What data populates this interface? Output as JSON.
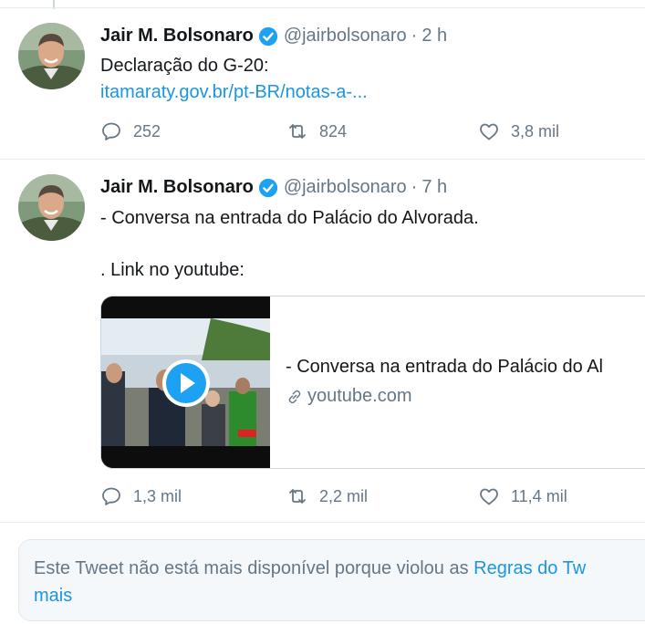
{
  "tweets": [
    {
      "author_name": "Jair M. Bolsonaro",
      "handle": "@jairbolsonaro",
      "separator": "·",
      "time": "2 h",
      "text_line1": "Declaração do G-20:",
      "link": "itamaraty.gov.br/pt-BR/notas-a-...",
      "replies": "252",
      "retweets": "824",
      "likes": "3,8 mil"
    },
    {
      "author_name": "Jair M. Bolsonaro",
      "handle": "@jairbolsonaro",
      "separator": "·",
      "time": "7 h",
      "text_line1": "- Conversa na entrada do Palácio do Alvorada.",
      "text_line2": ". Link no youtube:",
      "card": {
        "title": "- Conversa na entrada do Palácio do Al",
        "domain": "youtube.com"
      },
      "replies": "1,3 mil",
      "retweets": "2,2 mil",
      "likes": "11,4 mil"
    }
  ],
  "notice": {
    "line1_text": "Este Tweet não está mais disponível porque violou as ",
    "line1_link": "Regras do Tw",
    "line2_link": "mais"
  },
  "colors": {
    "link": "#1b95e0",
    "verified": "#1da1f2",
    "secondary_text": "#657786",
    "play_button": "#1da1f2"
  },
  "icons": [
    "verified-badge-icon",
    "reply-icon",
    "retweet-icon",
    "like-icon",
    "link-icon",
    "play-icon"
  ]
}
